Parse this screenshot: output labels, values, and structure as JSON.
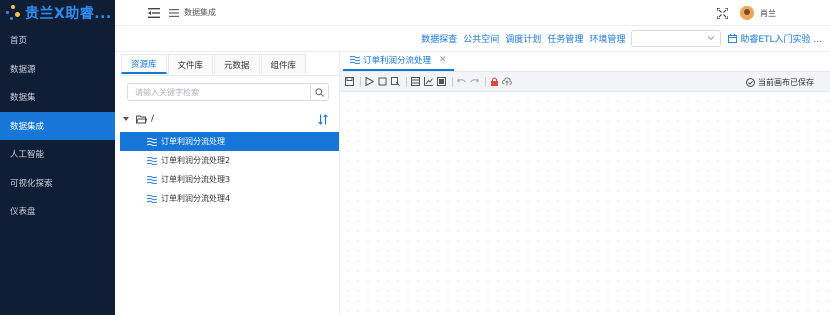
{
  "brand": {
    "title": "贵兰X助睿...",
    "logo_icon": "sparkle-logo"
  },
  "sidebar": {
    "items": [
      {
        "label": "首页",
        "active": false
      },
      {
        "label": "数据源",
        "active": false
      },
      {
        "label": "数据集",
        "active": false
      },
      {
        "label": "数据集成",
        "active": true
      },
      {
        "label": "人工智能",
        "active": false
      },
      {
        "label": "可视化探索",
        "active": false
      },
      {
        "label": "仪表盘",
        "active": false
      }
    ]
  },
  "header": {
    "breadcrumb": "数据集成",
    "username": "肖兰",
    "icons": [
      "menu-collapse-icon",
      "list-icon",
      "fullscreen-icon"
    ]
  },
  "links": {
    "items": [
      "数据探查",
      "公共空间",
      "调度计划",
      "任务管理",
      "环境管理"
    ],
    "select_value": "",
    "guide": "助睿ETL入门实验 ..."
  },
  "leftpanel": {
    "tabs": [
      "资源库",
      "文件库",
      "元数据",
      "组件库"
    ],
    "active_tab": "资源库",
    "search_placeholder": "请输入关键字检索",
    "root_label": "/",
    "tree_items": [
      "订单利润分流处理",
      "订单利润分流处理2",
      "订单利润分流处理3",
      "订单利润分流处理4"
    ],
    "selected_item": "订单利润分流处理"
  },
  "editor": {
    "tab_label": "订单利润分流处理",
    "status": "当前画布已保存"
  },
  "colors": {
    "sidebar_bg": "#0f1e35",
    "accent": "#1677d8",
    "brand": "#2f8cf0"
  }
}
